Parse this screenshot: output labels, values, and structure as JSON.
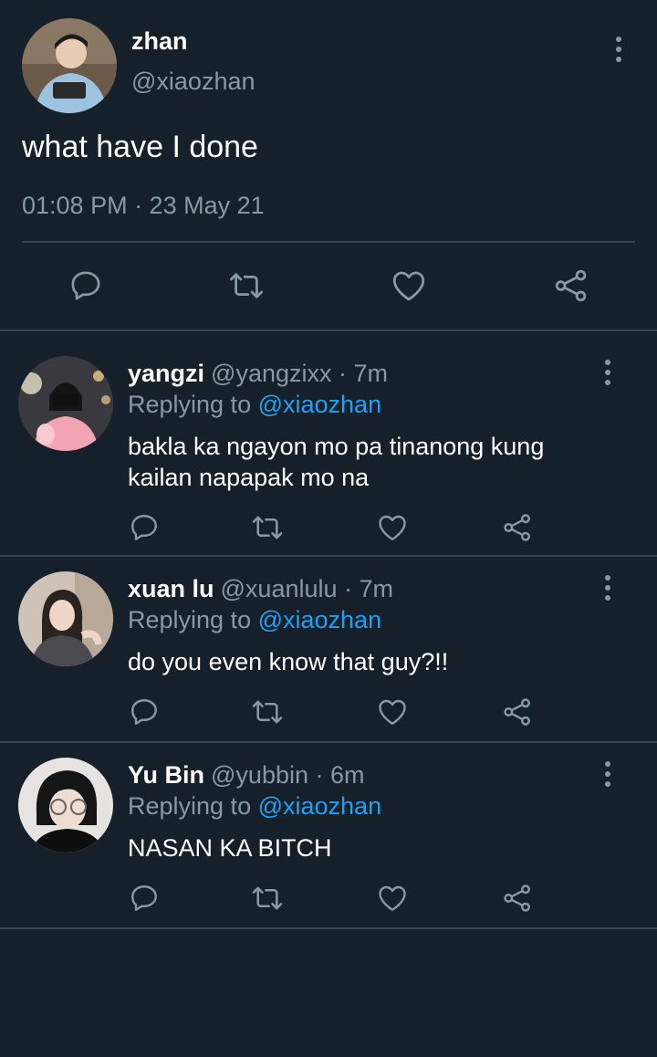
{
  "main": {
    "name": "zhan",
    "handle": "@xiaozhan",
    "text": "what have I done",
    "meta": "01:08 PM · 23 May 21"
  },
  "replies": [
    {
      "name": "yangzi",
      "handle": "@yangzixx",
      "dot": " · ",
      "time": "7m",
      "replying_prefix": "Replying to ",
      "replying_to": "@xiaozhan",
      "text": "bakla ka ngayon mo pa tinanong kung kailan napapak mo na"
    },
    {
      "name": "xuan lu",
      "handle": "@xuanlulu",
      "dot": " · ",
      "time": "7m",
      "replying_prefix": "Replying to ",
      "replying_to": "@xiaozhan",
      "text": "do you even know that guy?!!"
    },
    {
      "name": "Yu Bin",
      "handle": "@yubbin",
      "dot": " · ",
      "time": "6m",
      "replying_prefix": "Replying to ",
      "replying_to": "@xiaozhan",
      "text": "NASAN KA BITCH"
    }
  ],
  "colors": {
    "background": "#15202b",
    "secondary_text": "#8899a6",
    "mention": "#1da1f2",
    "divider": "#38444d"
  }
}
